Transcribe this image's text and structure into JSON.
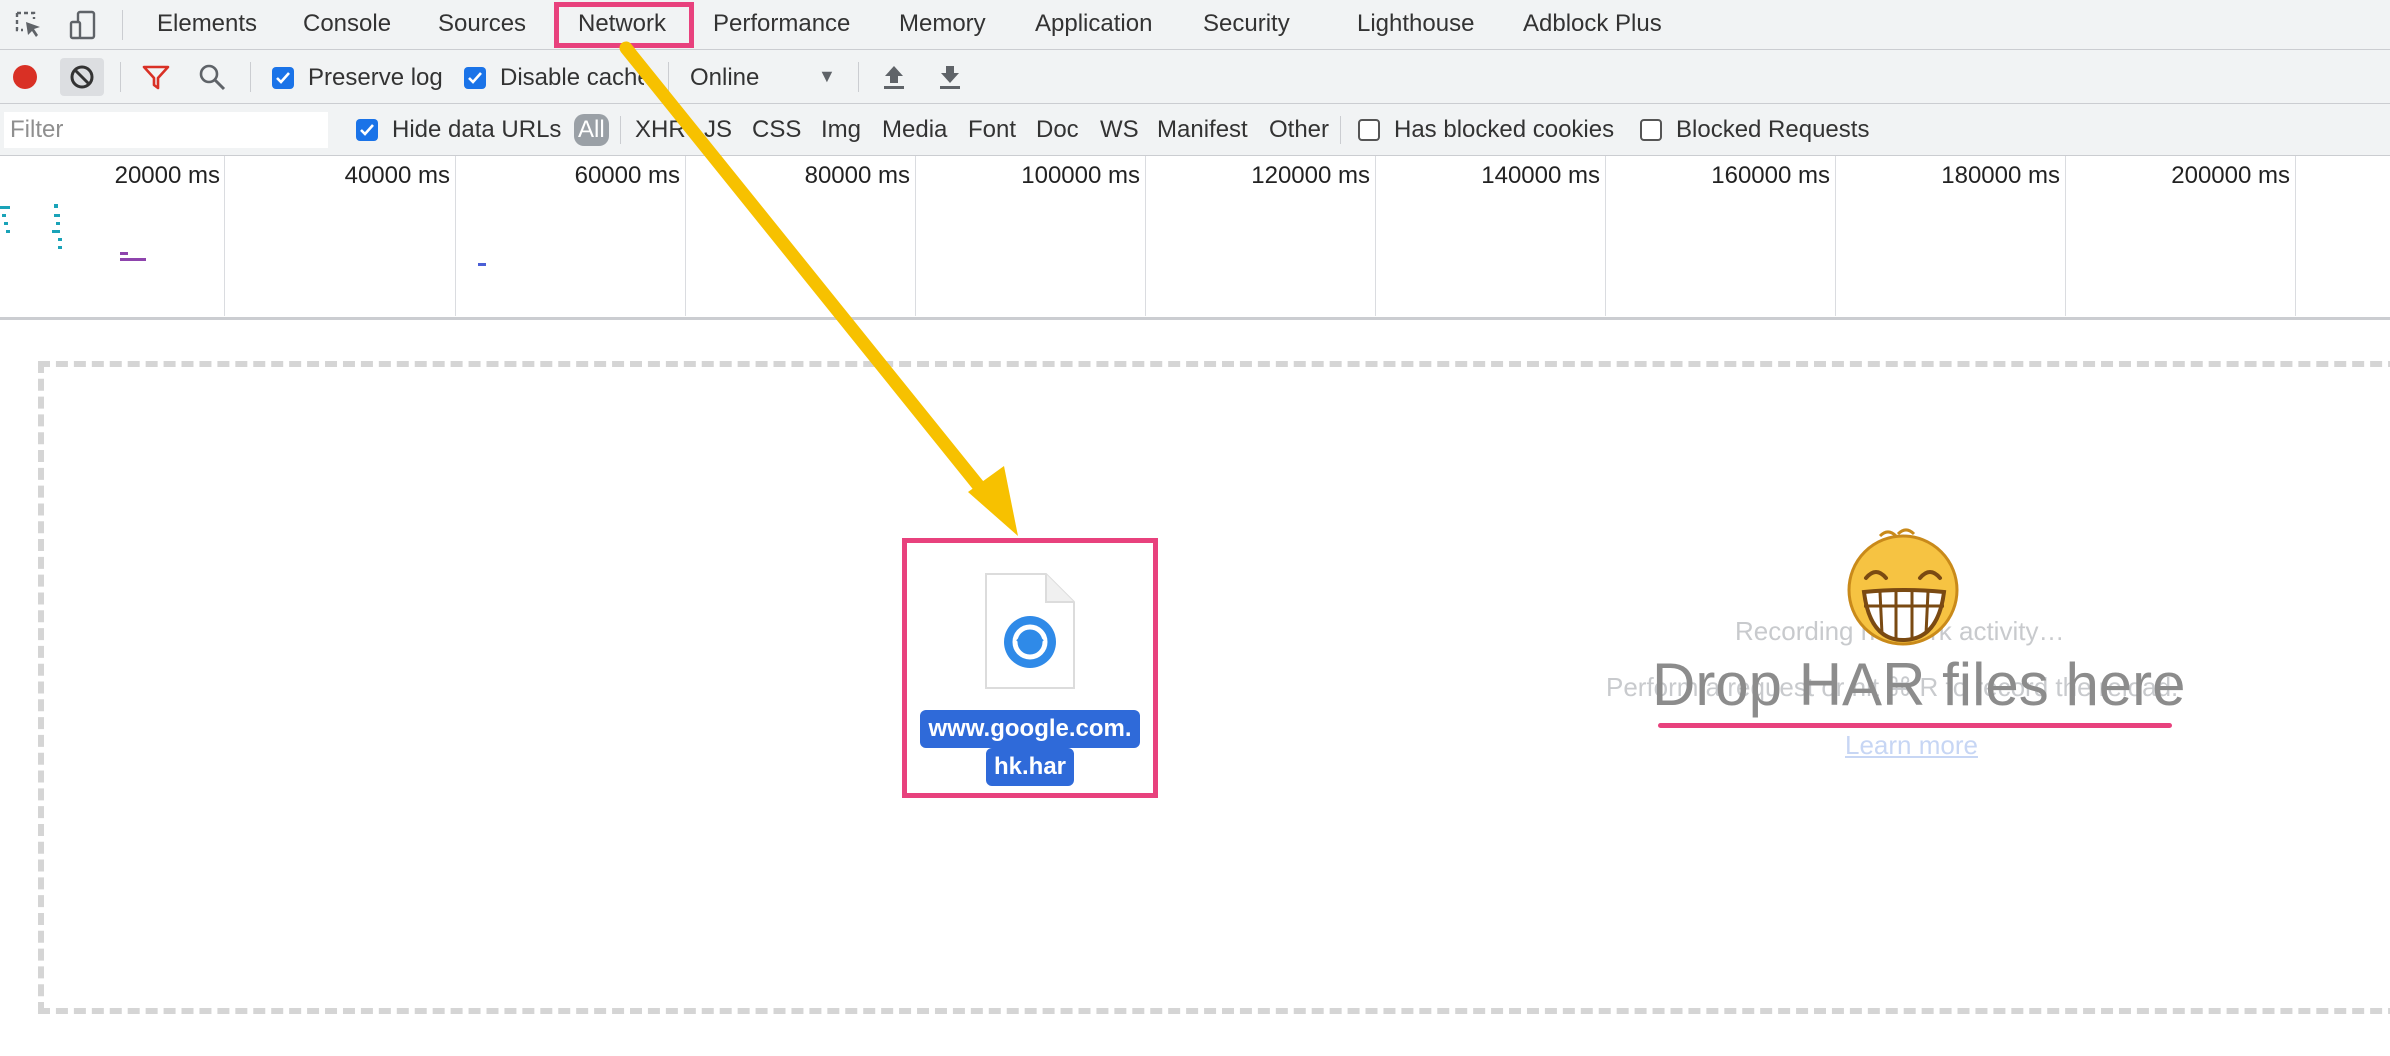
{
  "tabs": [
    {
      "label": "Elements"
    },
    {
      "label": "Console"
    },
    {
      "label": "Sources"
    },
    {
      "label": "Network",
      "active": true
    },
    {
      "label": "Performance"
    },
    {
      "label": "Memory"
    },
    {
      "label": "Application"
    },
    {
      "label": "Security"
    },
    {
      "label": "Lighthouse"
    },
    {
      "label": "Adblock Plus"
    }
  ],
  "toolbar": {
    "preserve_log": {
      "label": "Preserve log",
      "checked": true
    },
    "disable_cache": {
      "label": "Disable cache",
      "checked": true
    },
    "throttling": {
      "selected": "Online"
    }
  },
  "filter": {
    "placeholder": "Filter",
    "hide_data_urls": {
      "label": "Hide data URLs",
      "checked": true
    },
    "types": [
      "All",
      "XHR",
      "JS",
      "CSS",
      "Img",
      "Media",
      "Font",
      "Doc",
      "WS",
      "Manifest",
      "Other"
    ],
    "has_blocked_cookies": {
      "label": "Has blocked cookies",
      "checked": false
    },
    "blocked_requests": {
      "label": "Blocked Requests",
      "checked": false
    }
  },
  "overview": {
    "ticks": [
      "20000 ms",
      "40000 ms",
      "60000 ms",
      "80000 ms",
      "100000 ms",
      "120000 ms",
      "140000 ms",
      "160000 ms",
      "180000 ms",
      "200000 ms"
    ]
  },
  "empty_state": {
    "recording_text": "Recording network activity…",
    "perform_text": "Perform a request or hit ⌘ R to record the reload.",
    "learn_more": "Learn more"
  },
  "overlay": {
    "drop_title": "Drop HAR files here",
    "file_name_line1": "www.google.com.",
    "file_name_line2": "hk.har"
  },
  "colors": {
    "accent": "#1a73e8",
    "highlight": "#e8417d",
    "arrow": "#f7c100",
    "record": "#d93025",
    "filter_icon": "#d93025"
  }
}
